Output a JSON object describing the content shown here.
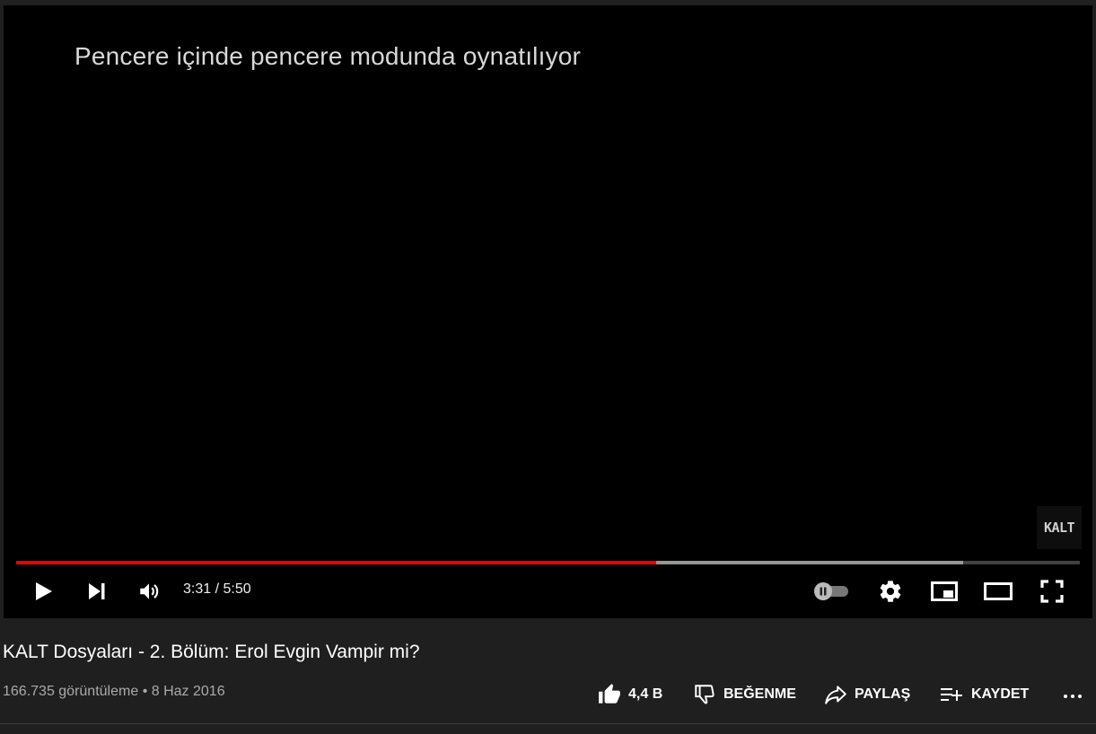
{
  "player": {
    "pip_message": "Pencere içinde pencere modunda oynatılıyor",
    "watermark": "KALT",
    "progress": {
      "played_fraction": 0.602,
      "buffered_fraction": 0.89
    },
    "time": {
      "current": "3:31",
      "separator": "/",
      "duration": "5:50",
      "display": "3:31 / 5:50"
    },
    "autoplay_on": false,
    "colors": {
      "progress_played": "#ee0000",
      "background": "#000000"
    }
  },
  "video": {
    "title": "KALT Dosyaları - 2. Bölüm: Erol Evgin Vampir mi?",
    "views": "166.735 görüntüleme",
    "dot": "•",
    "date": "8 Haz 2016"
  },
  "actions": {
    "like_count": "4,4 B",
    "dislike_label": "BEĞENME",
    "share_label": "PAYLAŞ",
    "save_label": "KAYDET"
  },
  "icons": [
    "play-icon",
    "next-icon",
    "volume-icon",
    "autoplay-toggle-icon",
    "settings-icon",
    "miniplayer-icon",
    "theater-icon",
    "fullscreen-icon",
    "like-icon",
    "dislike-icon",
    "share-icon",
    "save-playlist-icon",
    "more-icon"
  ]
}
